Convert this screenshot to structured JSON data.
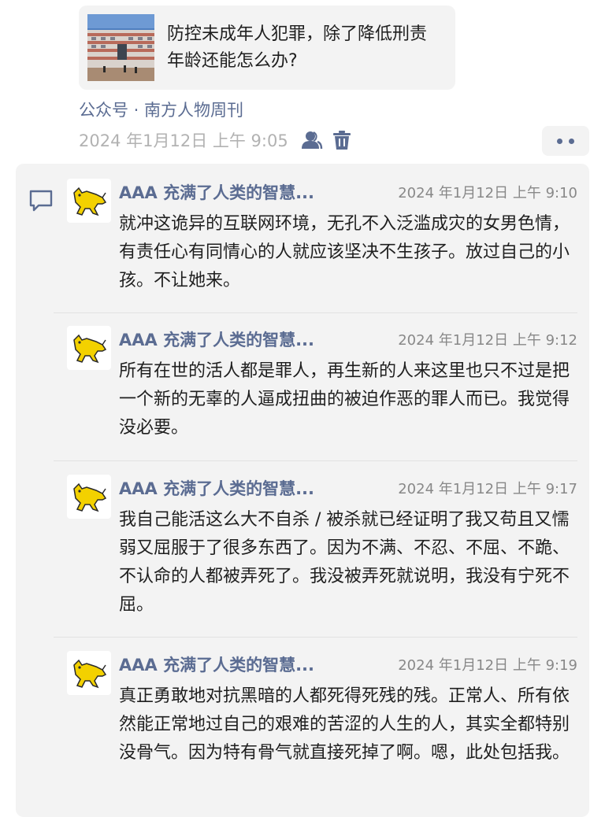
{
  "article": {
    "title": "防控未成年人犯罪，除了降低刑责年龄还能怎么办?",
    "source": "公众号 · 南方人物周刊",
    "date": "2024 年1月12日 上午 9:05"
  },
  "icons": {
    "thumbnail": "school-building-photo",
    "author": "user-icon",
    "delete": "trash-icon",
    "more": "more-dots-icon",
    "comment": "comment-icon",
    "avatar": "yellow-cat-avatar"
  },
  "colors": {
    "link": "#5b6c92",
    "panel": "#f3f3f3",
    "avatar_cat": "#f3d100"
  },
  "comments": [
    {
      "name": "AAA 充满了人类的智慧...",
      "time": "2024 年1月12日 上午 9:10",
      "text": "就冲这诡异的互联网环境，无孔不入泛滥成灾的女男色情，有责任心有同情心的人就应该坚决不生孩子。放过自己的小孩。不让她来。"
    },
    {
      "name": "AAA 充满了人类的智慧...",
      "time": "2024 年1月12日 上午 9:12",
      "text": "所有在世的活人都是罪人，再生新的人来这里也只不过是把一个新的无辜的人逼成扭曲的被迫作恶的罪人而已。我觉得没必要。"
    },
    {
      "name": "AAA 充满了人类的智慧...",
      "time": "2024 年1月12日 上午 9:17",
      "text": "我自己能活这么大不自杀 / 被杀就已经证明了我又苟且又懦弱又屈服于了很多东西了。因为不满、不忍、不屈、不跪、不认命的人都被弄死了。我没被弄死就说明，我没有宁死不屈。"
    },
    {
      "name": "AAA 充满了人类的智慧...",
      "time": "2024 年1月12日 上午 9:19",
      "text": "真正勇敢地对抗黑暗的人都死得死残的残。正常人、所有依然能正常地过自己的艰难的苦涩的人生的人，其实全都特别没骨气。因为特有骨气就直接死掉了啊。嗯，此处包括我。"
    }
  ]
}
